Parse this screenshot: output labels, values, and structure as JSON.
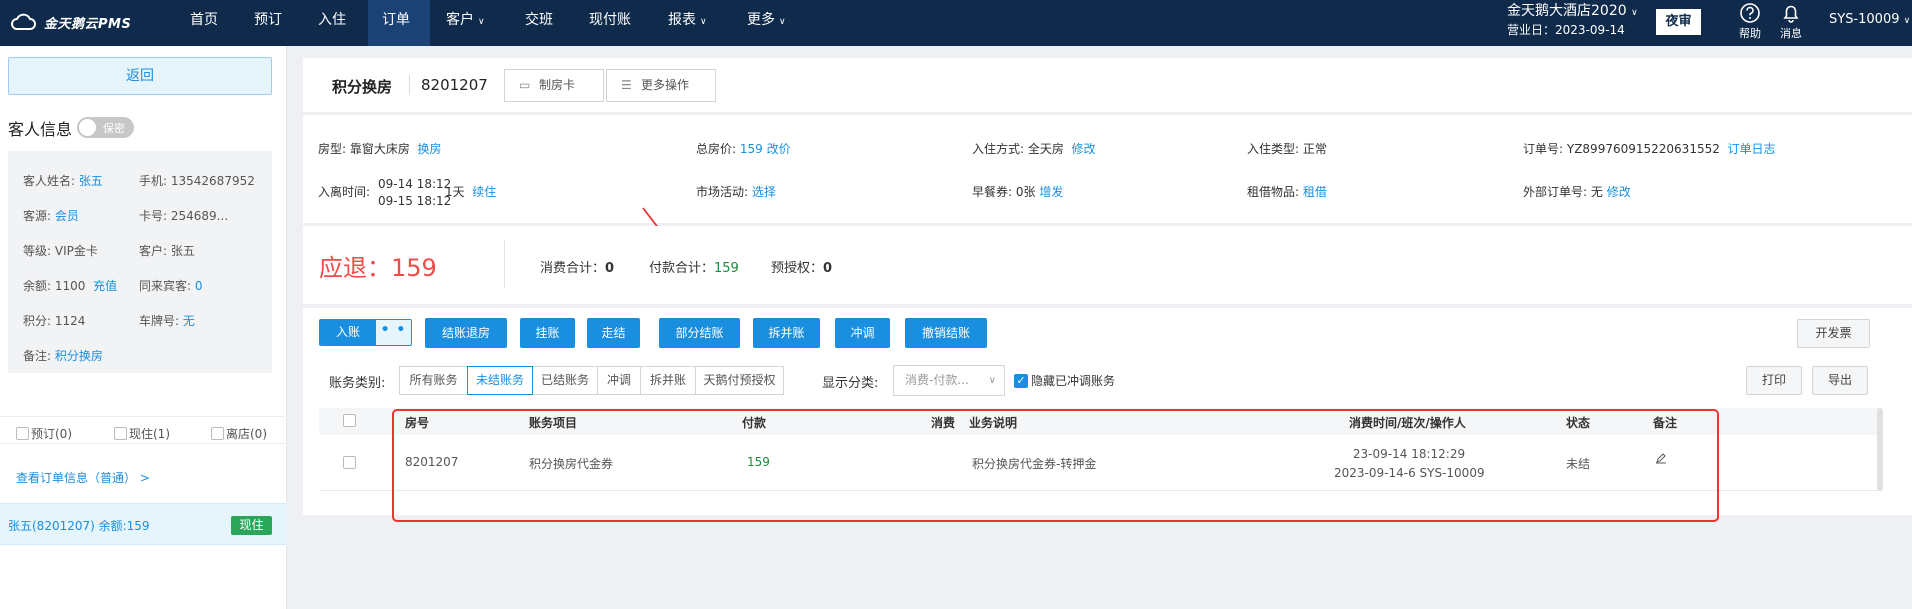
{
  "app": {
    "logo_text": "金天鹅云PMS",
    "nav": [
      {
        "label": "首页",
        "caret": false
      },
      {
        "label": "预订",
        "caret": false
      },
      {
        "label": "入住",
        "caret": false
      },
      {
        "label": "订单",
        "caret": false
      },
      {
        "label": "客户",
        "caret": true
      },
      {
        "label": "交班",
        "caret": false
      },
      {
        "label": "现付账",
        "caret": false
      },
      {
        "label": "报表",
        "caret": true
      },
      {
        "label": "更多",
        "caret": true
      }
    ],
    "active_nav": "订单",
    "hotel_name": "金天鹅大酒店2020",
    "business_date": "营业日：2023-09-14",
    "night_audit": "夜审",
    "help": "帮助",
    "messages": "消息",
    "user": "SYS-10009"
  },
  "left": {
    "back_label": "返回",
    "guest_info_title": "客人信息",
    "privacy_toggle": "保密",
    "guest": {
      "name_label": "客人姓名:",
      "name": "张五",
      "phone_label": "手机:",
      "phone": "13542687952",
      "source_label": "客源:",
      "source": "会员",
      "card_label": "卡号:",
      "card": "254689...",
      "level_label": "等级:",
      "level": "VIP金卡",
      "customer_label": "客户:",
      "customer": "张五",
      "balance_label": "余额:",
      "balance": "1100",
      "recharge": "充值",
      "companions_label": "同来宾客:",
      "companions": "0",
      "points_label": "积分:",
      "points": "1124",
      "plate_label": "车牌号:",
      "plate": "无",
      "remark_label": "备注:",
      "remark": "积分换房"
    },
    "filters": {
      "reserved": "预订(0)",
      "in_house": "现住(1)",
      "departed": "离店(0)"
    },
    "view_order_info": "查看订单信息（普通） >",
    "room": {
      "text": "张五(8201207)  余额:159",
      "status": "现住"
    }
  },
  "header": {
    "title": "积分换房",
    "order_no": "8201207",
    "make_card": "制房卡",
    "more_ops": "更多操作"
  },
  "info": {
    "room_type_label": "房型:",
    "room_type": "靠窗大床房",
    "change_room": "换房",
    "total_price_label": "总房价:",
    "total_price": "159",
    "change_price": "改价",
    "checkin_method_label": "入住方式:",
    "checkin_method": "全天房",
    "modify": "修改",
    "checkin_type_label": "入住类型:",
    "checkin_type": "正常",
    "order_id_label": "订单号:",
    "order_id": "YZ899760915220631552",
    "order_log": "订单日志",
    "stay_label": "入离时间:",
    "arrive": "09-14 18:12",
    "depart": "09-15 18:12",
    "nights": "1天",
    "extend": "续住",
    "marketing_label": "市场活动:",
    "marketing_select": "选择",
    "breakfast_label": "早餐券:",
    "breakfast": "0张",
    "breakfast_add": "增发",
    "rental_label": "租借物品:",
    "rental": "租借",
    "external_order_label": "外部订单号:",
    "external_order": "无",
    "external_modify": "修改"
  },
  "summary": {
    "refund_label": "应退：159",
    "consumption_label": "消费合计：",
    "consumption": "0",
    "payment_label": "付款合计：",
    "payment": "159",
    "preauth_label": "预授权：",
    "preauth": "0"
  },
  "actions": {
    "post": "入账",
    "post_more": "• • •",
    "buttons": [
      "结账退房",
      "挂账",
      "走结",
      "部分结账",
      "拆并账",
      "冲调",
      "撤销结账"
    ],
    "invoice": "开发票",
    "print": "打印",
    "export": "导出"
  },
  "filters": {
    "category_label": "账务类别:",
    "segments": [
      "所有账务",
      "未结账务",
      "已结账务",
      "冲调",
      "拆并账",
      "天鹅付预授权"
    ],
    "active_segment": "未结账务",
    "display_label": "显示分类:",
    "display_placeholder": "消费-付款...",
    "hide_reversed": "隐藏已冲调账务"
  },
  "table": {
    "columns": [
      "房号",
      "账务项目",
      "付款",
      "消费",
      "业务说明",
      "消费时间/班次/操作人",
      "状态",
      "备注"
    ],
    "rows": [
      {
        "room": "8201207",
        "item": "积分换房代金券",
        "payment": "159",
        "consumption": "",
        "description": "积分换房代金券-转押金",
        "time": "23-09-14 18:12:29",
        "shift": "2023-09-14-6 SYS-10009",
        "status": "未结"
      }
    ]
  },
  "colors": {
    "nav_bg": "#0f2a4a",
    "accent": "#1a8fe0",
    "refund": "#f04b48",
    "green": "#2aa65b",
    "annotation": "#e33333"
  }
}
